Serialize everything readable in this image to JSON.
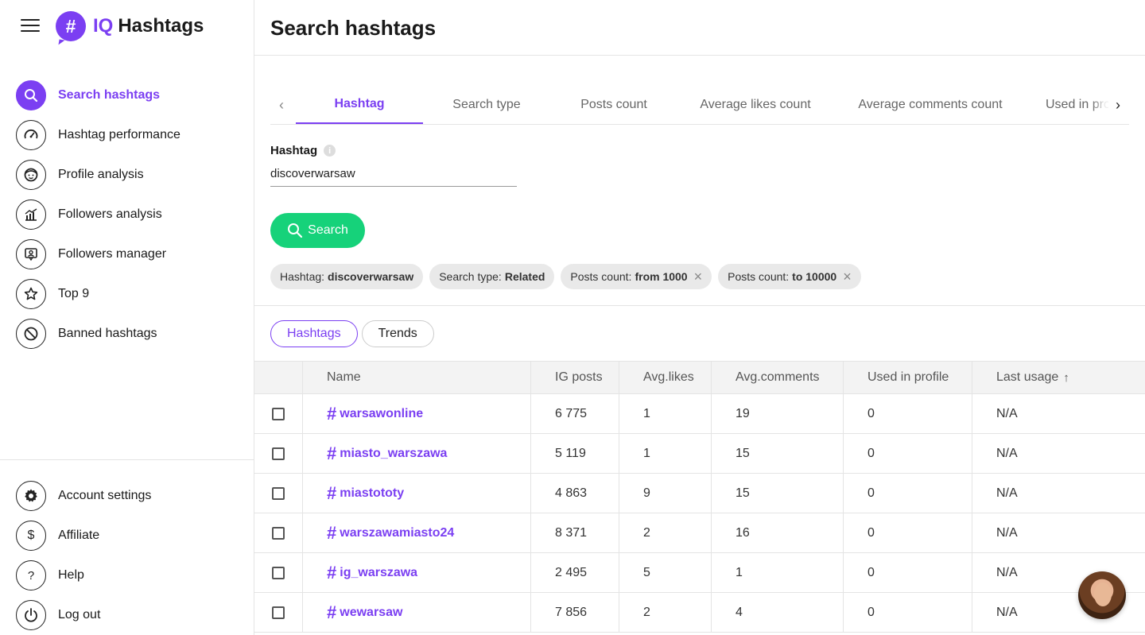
{
  "app": {
    "logo_badge": "#",
    "logo_iq": "IQ",
    "logo_name": "Hashtags"
  },
  "sidebar": {
    "items": [
      {
        "label": "Search hashtags",
        "icon": "search-icon"
      },
      {
        "label": "Hashtag performance",
        "icon": "gauge-icon"
      },
      {
        "label": "Profile analysis",
        "icon": "face-icon"
      },
      {
        "label": "Followers analysis",
        "icon": "chart-icon"
      },
      {
        "label": "Followers manager",
        "icon": "user-card-icon"
      },
      {
        "label": "Top 9",
        "icon": "star-icon"
      },
      {
        "label": "Banned hashtags",
        "icon": "ban-icon"
      }
    ],
    "bottom_items": [
      {
        "label": "Account settings",
        "icon": "gear-icon"
      },
      {
        "label": "Affiliate",
        "icon": "dollar-icon"
      },
      {
        "label": "Help",
        "icon": "question-icon"
      },
      {
        "label": "Log out",
        "icon": "power-icon"
      }
    ]
  },
  "header": {
    "title": "Search hashtags"
  },
  "filter_tabs": [
    "Hashtag",
    "Search type",
    "Posts count",
    "Average likes count",
    "Average comments count",
    "Used in profile"
  ],
  "form": {
    "label": "Hashtag",
    "value": "discoverwarsaw",
    "search_label": "Search"
  },
  "chips": [
    {
      "key": "Hashtag:",
      "value": "discoverwarsaw",
      "removable": false
    },
    {
      "key": "Search type:",
      "value": "Related",
      "removable": false
    },
    {
      "key": "Posts count:",
      "value": "from 1000",
      "removable": true
    },
    {
      "key": "Posts count:",
      "value": "to 10000",
      "removable": true
    }
  ],
  "view_toggle": [
    "Hashtags",
    "Trends"
  ],
  "table": {
    "columns": [
      "Name",
      "IG posts",
      "Avg.likes",
      "Avg.comments",
      "Used in profile",
      "Last usage"
    ],
    "sort_indicator": "↑",
    "rows": [
      {
        "name": "warsawonline",
        "posts": "6 775",
        "likes": "1",
        "comments": "19",
        "used": "0",
        "last": "N/A"
      },
      {
        "name": "miasto_warszawa",
        "posts": "5 119",
        "likes": "1",
        "comments": "15",
        "used": "0",
        "last": "N/A"
      },
      {
        "name": "miastototy",
        "posts": "4 863",
        "likes": "9",
        "comments": "15",
        "used": "0",
        "last": "N/A"
      },
      {
        "name": "warszawamiasto24",
        "posts": "8 371",
        "likes": "2",
        "comments": "16",
        "used": "0",
        "last": "N/A"
      },
      {
        "name": "ig_warszawa",
        "posts": "2 495",
        "likes": "5",
        "comments": "1",
        "used": "0",
        "last": "N/A"
      },
      {
        "name": "wewarsaw",
        "posts": "7 856",
        "likes": "2",
        "comments": "4",
        "used": "0",
        "last": "N/A"
      }
    ]
  },
  "colors": {
    "accent": "#7b3ff2",
    "search_button": "#16d27a"
  }
}
